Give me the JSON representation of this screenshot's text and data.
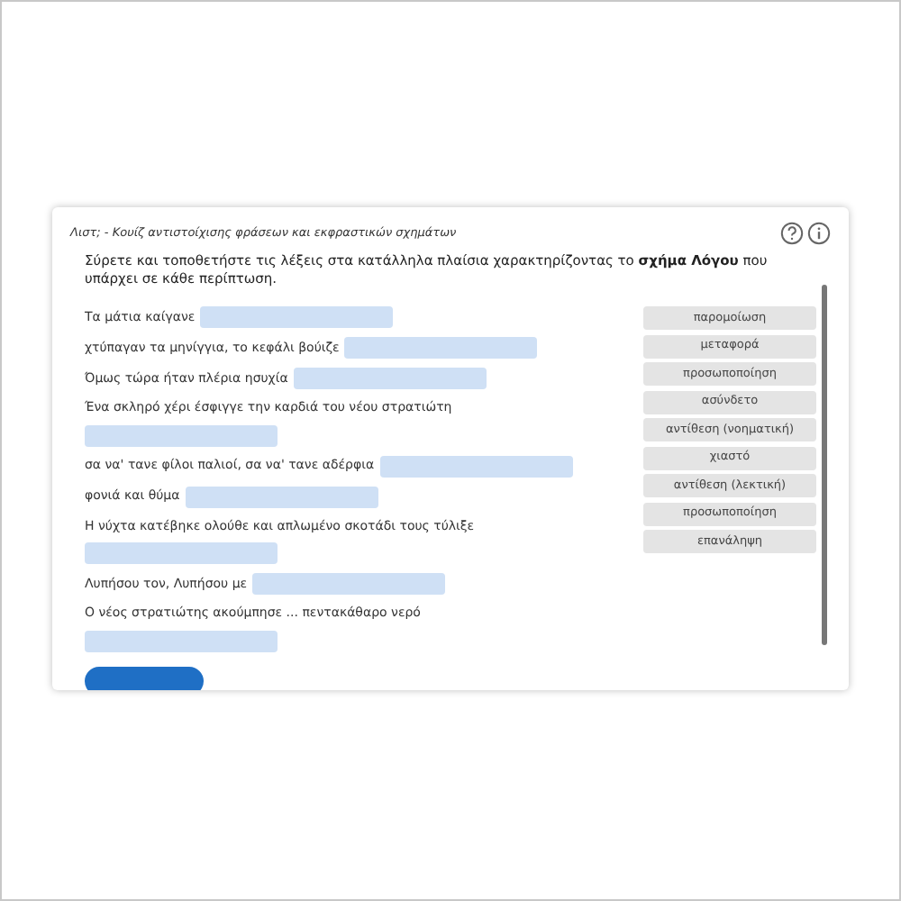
{
  "quiz": {
    "title": "Λιστ; - Κουίζ αντιστοίχισης φράσεων και εκφραστικών σχημάτων",
    "instruction": "Σύρετε και τοποθετήστε τις λέξεις στα κατάλληλα πλαίσια χαρακτηρίζοντας το **σχήμα Λόγου** που υπάρχει σε κάθε περίπτωση.",
    "phrases": [
      {
        "text": "Τα μάτια καίγανε",
        "kind": "inline"
      },
      {
        "text": "χτύπαγαν τα μηνίγγια, το κεφάλι βούιζε",
        "kind": "inline"
      },
      {
        "text": "Όμως τώρα ήταν πλέρια ησυχία",
        "kind": "inline"
      },
      {
        "text": "Ένα σκληρό χέρι έσφιγγε την καρδιά του νέου στρατιώτη",
        "kind": "wrapped"
      },
      {
        "text": "σα να' τανε φίλοι παλιοί, σα να' τανε αδέρφια",
        "kind": "inline"
      },
      {
        "text": "φονιά και θύμα",
        "kind": "inline"
      },
      {
        "text": "Η νύχτα κατέβηκε ολούθε και απλωμένο σκοτάδι τους τύλιξε",
        "kind": "wrapped"
      },
      {
        "text": "Λυπήσου τον, Λυπήσου με",
        "kind": "inline"
      },
      {
        "text": "Ο νέος στρατιώτης ακούμπησε ... πεντακάθαρο νερό",
        "kind": "wrapped"
      }
    ],
    "choices": [
      "παρομοίωση",
      "μεταφορά",
      "προσωποποίηση",
      "ασύνδετο",
      "αντίθεση (νοηματική)",
      "χιαστό",
      "αντίθεση (λεκτική)",
      "προσωποποίηση",
      "επανάληψη"
    ]
  }
}
